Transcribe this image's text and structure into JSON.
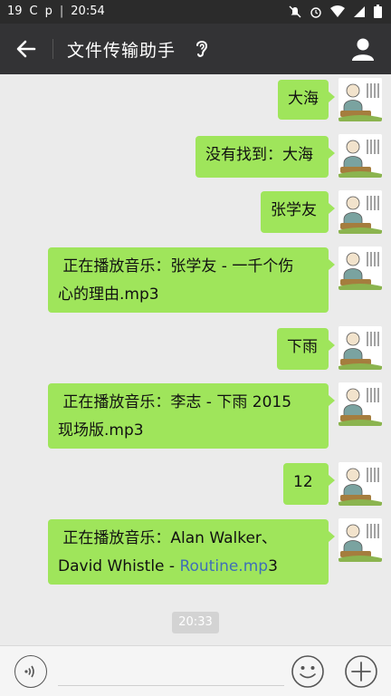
{
  "status_bar": {
    "left_items": [
      "19",
      "C",
      "p"
    ],
    "time": "20:54"
  },
  "header": {
    "title": "文件传输助手"
  },
  "messages": [
    {
      "text": "大海"
    },
    {
      "text": "没有找到：大海"
    },
    {
      "text": "张学友"
    },
    {
      "line1": " 正在播放音乐：张学友 - 一千个伤",
      "line2": "心的理由.mp3"
    },
    {
      "text": "下雨"
    },
    {
      "line1": " 正在播放音乐：李志 - 下雨 2015",
      "line2": "现场版.mp3"
    },
    {
      "text": "12"
    },
    {
      "line1": " 正在播放音乐：Alan Walker、",
      "line2_pre": "David Whistle - ",
      "line2_link": "Routine.mp",
      "line2_post": "3"
    }
  ],
  "timestamp": "20:33",
  "input": {
    "value": ""
  },
  "colors": {
    "header_bg": "#333335",
    "status_bg": "#2b2b2b",
    "bubble": "#9fe55b",
    "chat_bg": "#ebebeb",
    "link": "#3f6fb7"
  }
}
